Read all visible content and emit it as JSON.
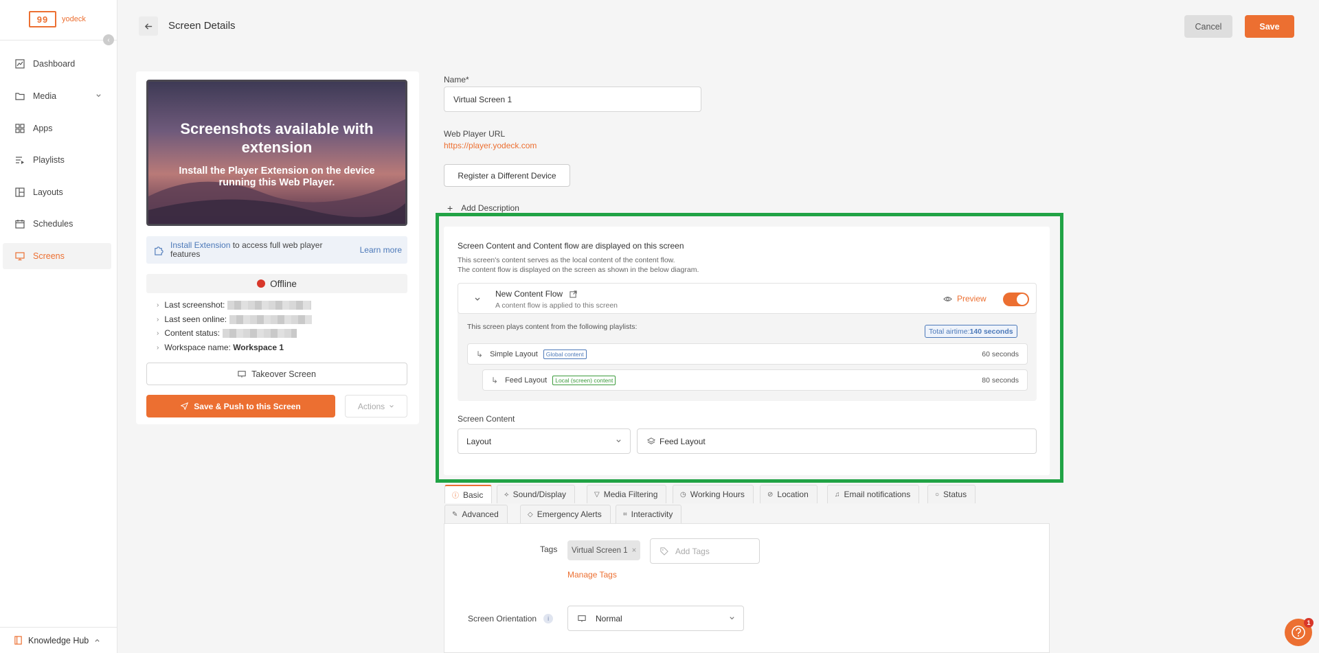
{
  "brand": {
    "logo_mark": "99",
    "logo_text": "yodeck",
    "accent": "#ec6f31"
  },
  "sidebar": {
    "items": [
      {
        "label": "Dashboard",
        "icon": "chart-icon"
      },
      {
        "label": "Media",
        "icon": "folder-icon"
      },
      {
        "label": "Apps",
        "icon": "apps-icon"
      },
      {
        "label": "Playlists",
        "icon": "playlist-icon"
      },
      {
        "label": "Layouts",
        "icon": "layout-icon"
      },
      {
        "label": "Schedules",
        "icon": "calendar-icon"
      },
      {
        "label": "Screens",
        "icon": "monitor-icon"
      }
    ],
    "footer_label": "Knowledge Hub"
  },
  "header": {
    "title": "Screen Details",
    "cancel_label": "Cancel",
    "save_label": "Save"
  },
  "preview": {
    "title": "Screenshots available with extension",
    "subtitle": "Install the Player Extension on the device running this Web Player."
  },
  "extension": {
    "link": "Install Extension",
    "text": " to access full web player features",
    "learn_more": "Learn more"
  },
  "status": {
    "label": "Offline",
    "color": "#d8372a"
  },
  "info": {
    "last_screenshot": "Last screenshot:",
    "last_seen": "Last seen online:",
    "content_status": "Content status:",
    "workspace_label": "Workspace name:",
    "workspace_value": "Workspace 1"
  },
  "actions": {
    "takeover": "Takeover Screen",
    "push": "Save & Push to this Screen",
    "actions": "Actions"
  },
  "form": {
    "name_label": "Name*",
    "name_value": "Virtual Screen 1",
    "url_label": "Web Player URL",
    "url_value": "https://player.yodeck.com",
    "register_label": "Register a Different Device",
    "add_description": "Add Description"
  },
  "content_flow": {
    "title": "Screen Content and Content flow are displayed on this screen",
    "desc_line1": "This screen's content serves as the local content of the content flow.",
    "desc_line2": "The content flow is displayed on the screen as shown in the below diagram.",
    "flow_name": "New Content Flow",
    "flow_sub": "A content flow is applied to this screen",
    "preview_label": "Preview",
    "toggle_on": true,
    "plays_text": "This screen plays content from the following playlists:",
    "airtime_label": "Total airtime: ",
    "airtime_value": "140 seconds",
    "playlists": [
      {
        "name": "Simple Layout",
        "tag": "Global content",
        "duration": "60 seconds"
      },
      {
        "name": "Feed Layout",
        "tag": "Local (screen) content",
        "duration": "80 seconds"
      }
    ],
    "screen_content_label": "Screen Content",
    "type_value": "Layout",
    "item_value": "Feed Layout"
  },
  "tabs": {
    "row1": [
      "Basic",
      "Sound/Display",
      "Media Filtering",
      "Working Hours",
      "Location",
      "Email notifications",
      "Status"
    ],
    "row2": [
      "Advanced",
      "Emergency Alerts",
      "Interactivity"
    ]
  },
  "basic": {
    "tags_label": "Tags",
    "tag_value": "Virtual Screen 1",
    "add_tags_placeholder": "Add Tags",
    "manage_tags": "Manage Tags",
    "orientation_label": "Screen Orientation",
    "orientation_value": "Normal"
  },
  "help": {
    "badge": "1"
  }
}
